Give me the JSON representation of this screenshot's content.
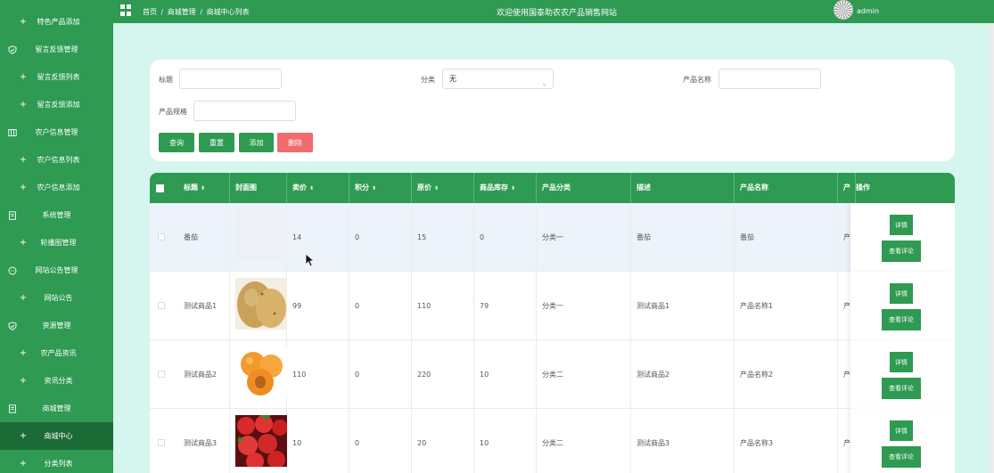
{
  "sidebar": {
    "items": [
      {
        "label": "特色产品添加",
        "icon": "plus-icon",
        "sub": true,
        "active": false
      },
      {
        "label": "留言反馈管理",
        "icon": "shield-icon",
        "sub": false,
        "active": false
      },
      {
        "label": "留言反馈列表",
        "icon": "plus-icon",
        "sub": true,
        "active": false
      },
      {
        "label": "留言反馈添加",
        "icon": "plus-icon",
        "sub": true,
        "active": false
      },
      {
        "label": "农户信息管理",
        "icon": "columns-icon",
        "sub": false,
        "active": false
      },
      {
        "label": "农户信息列表",
        "icon": "plus-icon",
        "sub": true,
        "active": false
      },
      {
        "label": "农户信息添加",
        "icon": "plus-icon",
        "sub": true,
        "active": false
      },
      {
        "label": "系统管理",
        "icon": "document-icon",
        "sub": false,
        "active": false
      },
      {
        "label": "轮播图管理",
        "icon": "plus-icon",
        "sub": true,
        "active": false
      },
      {
        "label": "网站公告管理",
        "icon": "chat-icon",
        "sub": false,
        "active": false
      },
      {
        "label": "网站公告",
        "icon": "plus-icon",
        "sub": true,
        "active": false
      },
      {
        "label": "资源管理",
        "icon": "shield-icon",
        "sub": false,
        "active": false
      },
      {
        "label": "农产品资讯",
        "icon": "plus-icon",
        "sub": true,
        "active": false
      },
      {
        "label": "资讯分类",
        "icon": "plus-icon",
        "sub": true,
        "active": false
      },
      {
        "label": "商城管理",
        "icon": "document-icon",
        "sub": false,
        "active": false
      },
      {
        "label": "商城中心",
        "icon": "plus-icon",
        "sub": true,
        "active": true
      },
      {
        "label": "分类列表",
        "icon": "plus-icon",
        "sub": true,
        "active": false
      }
    ]
  },
  "header": {
    "breadcrumb": [
      "首页",
      "/",
      "商城管理",
      "/",
      "商城中心列表"
    ],
    "site_title": "欢迎使用国泰助农农产品销售网站",
    "username": "admin"
  },
  "search": {
    "title_label": "标题",
    "title_value": "",
    "category_label": "分类",
    "category_value": "无",
    "product_name_label": "产品名称",
    "product_name_value": "",
    "spec_label": "产品规格",
    "spec_value": "",
    "buttons": {
      "query": "查询",
      "reset": "重置",
      "add": "添加",
      "delete": "删除"
    }
  },
  "table": {
    "columns": [
      "标题",
      "封面图",
      "卖价",
      "积分",
      "原价",
      "商品库存",
      "产品分类",
      "描述",
      "产品名称",
      "产",
      "操作"
    ],
    "rows": [
      {
        "title": "番茄",
        "image": "empty",
        "sell": "14",
        "points": "0",
        "orig": "15",
        "stock": "0",
        "cat": "分类一",
        "desc": "番茄",
        "name": "番茄",
        "p": "产"
      },
      {
        "title": "测试商品1",
        "image": "potato",
        "sell": "99",
        "points": "0",
        "orig": "110",
        "stock": "79",
        "cat": "分类一",
        "desc": "测试商品1",
        "name": "产品名称1",
        "p": "产"
      },
      {
        "title": "测试商品2",
        "image": "apricot",
        "sell": "110",
        "points": "0",
        "orig": "220",
        "stock": "10",
        "cat": "分类二",
        "desc": "测试商品2",
        "name": "产品名称2",
        "p": "产"
      },
      {
        "title": "测试商品3",
        "image": "strawberry",
        "sell": "10",
        "points": "0",
        "orig": "20",
        "stock": "10",
        "cat": "分类二",
        "desc": "测试商品3",
        "name": "产品名称3",
        "p": "产"
      }
    ],
    "op_detail": "详情",
    "op_comments": "查看评论"
  },
  "colors": {
    "primary": "#2e9a52",
    "danger": "#f06b6b",
    "background": "#d5f5ef",
    "active_sidebar": "#1b6b36"
  }
}
